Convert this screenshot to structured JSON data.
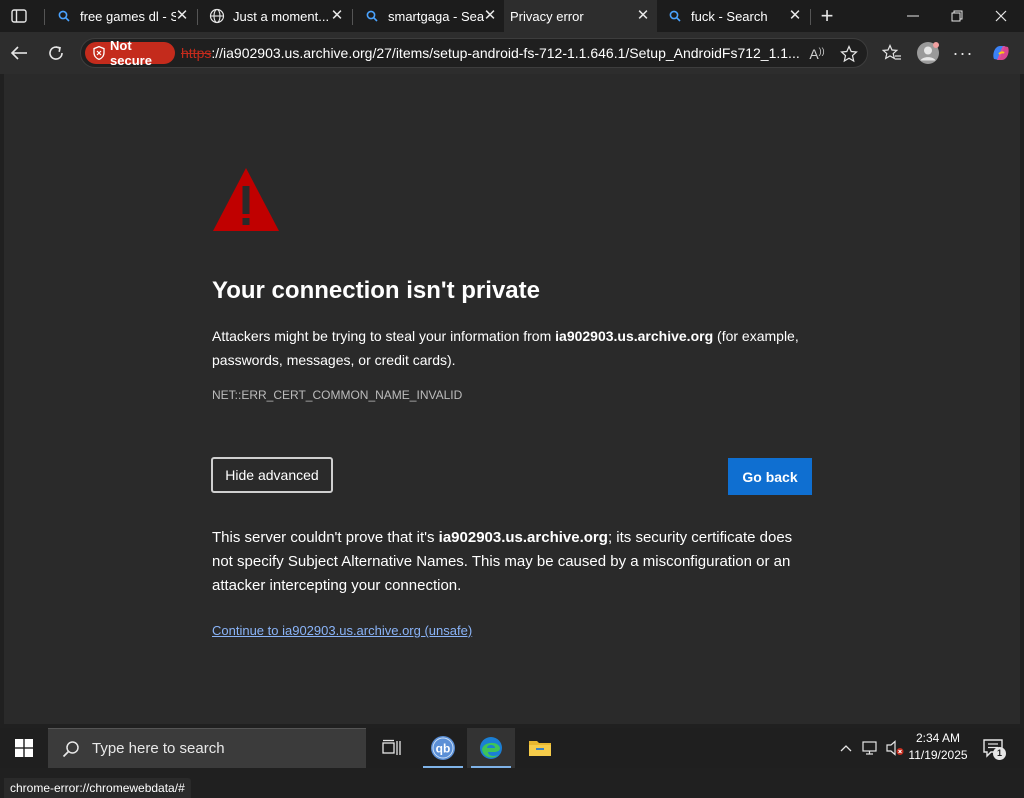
{
  "browser": {
    "tabs": [
      {
        "label": "free games dl - S",
        "icon": "search-icon",
        "active": false
      },
      {
        "label": "Just a moment...",
        "icon": "globe-icon",
        "active": false
      },
      {
        "label": "smartgaga - Sear",
        "icon": "search-icon",
        "active": false
      },
      {
        "label": "Privacy error",
        "icon": "none",
        "active": true
      },
      {
        "label": "fuck - Search",
        "icon": "search-icon",
        "active": false
      }
    ],
    "new_tab_label": "+",
    "address": {
      "security_label": "Not secure",
      "url_scheme": "https",
      "url_rest": "://ia902903.us.archive.org/27/items/setup-android-fs-712-1.1.646.1/Setup_AndroidFs712_1.1...."
    }
  },
  "error_page": {
    "title": "Your connection isn't private",
    "desc_prefix": "Attackers might be trying to steal your information from ",
    "desc_host": "ia902903.us.archive.org",
    "desc_suffix": " (for example, passwords, messages, or credit cards).",
    "error_code": "NET::ERR_CERT_COMMON_NAME_INVALID",
    "hide_advanced_label": "Hide advanced",
    "go_back_label": "Go back",
    "adv_prefix": "This server couldn't prove that it's ",
    "adv_host": "ia902903.us.archive.org",
    "adv_suffix": "; its security certificate does not specify Subject Alternative Names. This may be caused by a misconfiguration or an attacker intercepting your connection.",
    "continue_link": "Continue to ia902903.us.archive.org (unsafe)"
  },
  "status_bar": {
    "text": "chrome-error://chromewebdata/#"
  },
  "taskbar": {
    "search_placeholder": "Type here to search",
    "clock_time": "2:34 AM",
    "clock_date": "11/19/2025",
    "notification_count": "1"
  },
  "colors": {
    "warning_red": "#c00000",
    "not_secure_red": "#c42b1c",
    "primary_blue": "#0f6fd1",
    "link_blue": "#8ab4f8"
  }
}
